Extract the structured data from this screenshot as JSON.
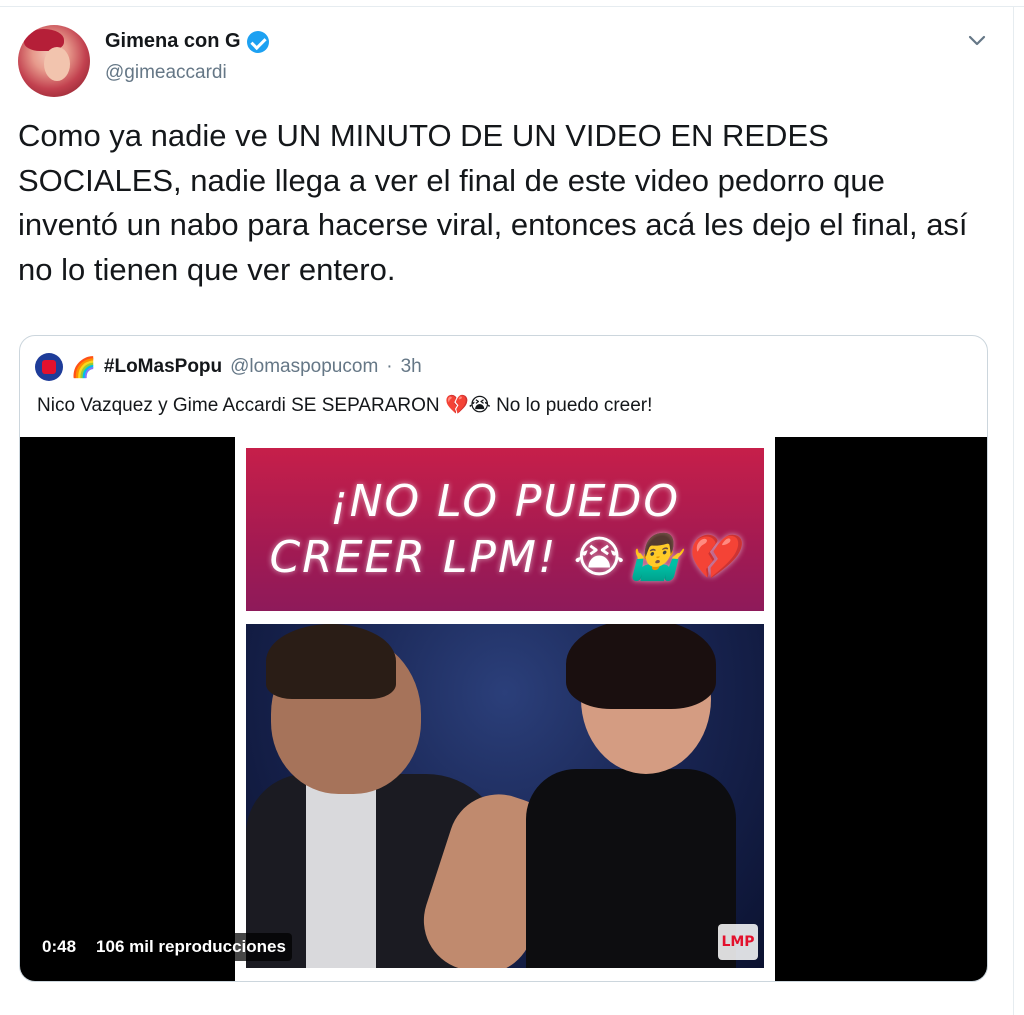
{
  "author": {
    "display_name": "Gimena con G",
    "handle": "@gimeaccardi",
    "verified": true
  },
  "icons": {
    "verified": "verified-badge-icon",
    "menu": "chevron-down-icon"
  },
  "tweet": {
    "text": "Como ya nadie ve UN MINUTO DE UN VIDEO EN REDES SOCIALES, nadie llega a ver el final de este video pedorro que inventó un nabo para hacerse viral, entonces acá les dejo el final, así no lo tienen que ver entero."
  },
  "quoted_tweet": {
    "rainbow_emoji": "🌈",
    "display_name": "#LoMasPopu",
    "handle": "@lomaspopucom",
    "separator": "·",
    "time": "3h",
    "text": "Nico Vazquez y Gime Accardi SE SEPARARON",
    "emojis": "💔😭",
    "text_after": "No lo puedo creer!",
    "video": {
      "banner_line1": "¡NO LO PUEDO",
      "banner_line2": "CREER LPM! 😭🤷‍♂️💔",
      "watermark": "LMP",
      "duration": "0:48",
      "views": "106 mil reproducciones"
    }
  },
  "colors": {
    "verified_blue": "#1da1f2",
    "secondary_text": "#657786",
    "border": "#ccd6dd",
    "banner_red": "#c61f4a"
  }
}
